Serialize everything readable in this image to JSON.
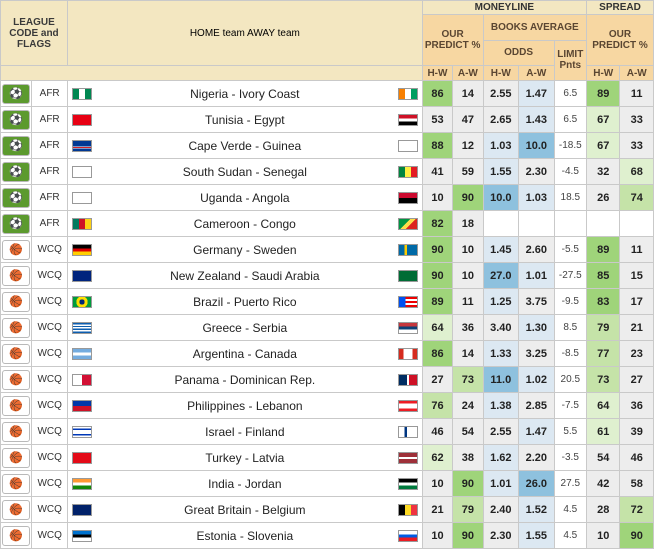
{
  "header": {
    "league_code_flags": "LEAGUE CODE and FLAGS",
    "teams": "HOME team    AWAY team",
    "moneyline": "MONEYLINE",
    "spread": "SPREAD",
    "our_predict_ml": "OUR PREDICT %",
    "books_average": "BOOKS AVERAGE",
    "odds": "ODDS",
    "limit_pnts": "LIMIT Pnts",
    "our_predict_sp": "OUR PREDICT %",
    "hw": "H-W",
    "aw": "A-W"
  },
  "rows": [
    {
      "sport": "soccer",
      "code": "AFR",
      "home": "Nigeria",
      "away": "Ivory Coast",
      "ml_hw": "86",
      "ml_aw": "14",
      "odds_h": "2.55",
      "odds_a": "1.47",
      "limit": "6.5",
      "sp_hw": "89",
      "sp_aw": "11"
    },
    {
      "sport": "soccer",
      "code": "AFR",
      "home": "Tunisia",
      "away": "Egypt",
      "ml_hw": "53",
      "ml_aw": "47",
      "odds_h": "2.65",
      "odds_a": "1.43",
      "limit": "6.5",
      "sp_hw": "67",
      "sp_aw": "33"
    },
    {
      "sport": "soccer",
      "code": "AFR",
      "home": "Cape Verde",
      "away": "Guinea",
      "ml_hw": "88",
      "ml_aw": "12",
      "odds_h": "1.03",
      "odds_a": "10.0",
      "limit": "-18.5",
      "sp_hw": "67",
      "sp_aw": "33"
    },
    {
      "sport": "soccer",
      "code": "AFR",
      "home": "South Sudan",
      "away": "Senegal",
      "ml_hw": "41",
      "ml_aw": "59",
      "odds_h": "1.55",
      "odds_a": "2.30",
      "limit": "-4.5",
      "sp_hw": "32",
      "sp_aw": "68"
    },
    {
      "sport": "soccer",
      "code": "AFR",
      "home": "Uganda",
      "away": "Angola",
      "ml_hw": "10",
      "ml_aw": "90",
      "odds_h": "10.0",
      "odds_a": "1.03",
      "limit": "18.5",
      "sp_hw": "26",
      "sp_aw": "74"
    },
    {
      "sport": "soccer",
      "code": "AFR",
      "home": "Cameroon",
      "away": "Congo",
      "ml_hw": "82",
      "ml_aw": "18",
      "odds_h": "",
      "odds_a": "",
      "limit": "",
      "sp_hw": "",
      "sp_aw": ""
    },
    {
      "sport": "basketball",
      "code": "WCQ",
      "home": "Germany",
      "away": "Sweden",
      "ml_hw": "90",
      "ml_aw": "10",
      "odds_h": "1.45",
      "odds_a": "2.60",
      "limit": "-5.5",
      "sp_hw": "89",
      "sp_aw": "11"
    },
    {
      "sport": "basketball",
      "code": "WCQ",
      "home": "New Zealand",
      "away": "Saudi Arabia",
      "ml_hw": "90",
      "ml_aw": "10",
      "odds_h": "27.0",
      "odds_a": "1.01",
      "limit": "-27.5",
      "sp_hw": "85",
      "sp_aw": "15"
    },
    {
      "sport": "basketball",
      "code": "WCQ",
      "home": "Brazil",
      "away": "Puerto Rico",
      "ml_hw": "89",
      "ml_aw": "11",
      "odds_h": "1.25",
      "odds_a": "3.75",
      "limit": "-9.5",
      "sp_hw": "83",
      "sp_aw": "17"
    },
    {
      "sport": "basketball",
      "code": "WCQ",
      "home": "Greece",
      "away": "Serbia",
      "ml_hw": "64",
      "ml_aw": "36",
      "odds_h": "3.40",
      "odds_a": "1.30",
      "limit": "8.5",
      "sp_hw": "79",
      "sp_aw": "21"
    },
    {
      "sport": "basketball",
      "code": "WCQ",
      "home": "Argentina",
      "away": "Canada",
      "ml_hw": "86",
      "ml_aw": "14",
      "odds_h": "1.33",
      "odds_a": "3.25",
      "limit": "-8.5",
      "sp_hw": "77",
      "sp_aw": "23"
    },
    {
      "sport": "basketball",
      "code": "WCQ",
      "home": "Panama",
      "away": "Dominican Rep.",
      "ml_hw": "27",
      "ml_aw": "73",
      "odds_h": "11.0",
      "odds_a": "1.02",
      "limit": "20.5",
      "sp_hw": "73",
      "sp_aw": "27"
    },
    {
      "sport": "basketball",
      "code": "WCQ",
      "home": "Philippines",
      "away": "Lebanon",
      "ml_hw": "76",
      "ml_aw": "24",
      "odds_h": "1.38",
      "odds_a": "2.85",
      "limit": "-7.5",
      "sp_hw": "64",
      "sp_aw": "36"
    },
    {
      "sport": "basketball",
      "code": "WCQ",
      "home": "Israel",
      "away": "Finland",
      "ml_hw": "46",
      "ml_aw": "54",
      "odds_h": "2.55",
      "odds_a": "1.47",
      "limit": "5.5",
      "sp_hw": "61",
      "sp_aw": "39"
    },
    {
      "sport": "basketball",
      "code": "WCQ",
      "home": "Turkey",
      "away": "Latvia",
      "ml_hw": "62",
      "ml_aw": "38",
      "odds_h": "1.62",
      "odds_a": "2.20",
      "limit": "-3.5",
      "sp_hw": "54",
      "sp_aw": "46"
    },
    {
      "sport": "basketball",
      "code": "WCQ",
      "home": "India",
      "away": "Jordan",
      "ml_hw": "10",
      "ml_aw": "90",
      "odds_h": "1.01",
      "odds_a": "26.0",
      "limit": "27.5",
      "sp_hw": "42",
      "sp_aw": "58"
    },
    {
      "sport": "basketball",
      "code": "WCQ",
      "home": "Great Britain",
      "away": "Belgium",
      "ml_hw": "21",
      "ml_aw": "79",
      "odds_h": "2.40",
      "odds_a": "1.52",
      "limit": "4.5",
      "sp_hw": "28",
      "sp_aw": "72"
    },
    {
      "sport": "basketball",
      "code": "WCQ",
      "home": "Estonia",
      "away": "Slovenia",
      "ml_hw": "10",
      "ml_aw": "90",
      "odds_h": "2.30",
      "odds_a": "1.55",
      "limit": "4.5",
      "sp_hw": "10",
      "sp_aw": "90"
    }
  ]
}
